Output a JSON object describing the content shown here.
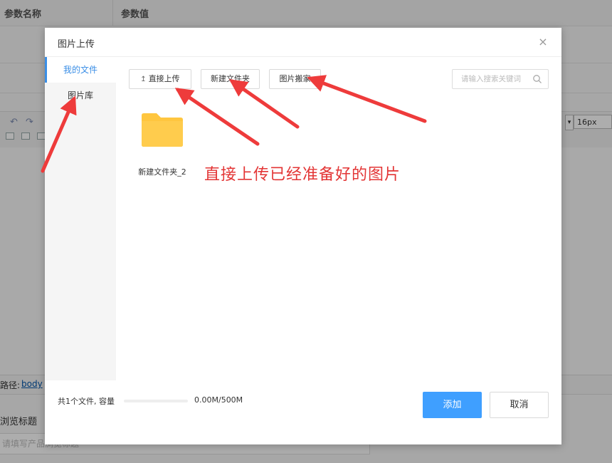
{
  "background": {
    "table_headers": [
      "参数名称",
      "参数值"
    ],
    "font_size_value": "16px",
    "select_arrow": "▾",
    "path_label": "路径:",
    "path_link": "body",
    "field_label": "浏览标题",
    "field_placeholder": "请填写产品浏览标题"
  },
  "dialog": {
    "title": "图片上传",
    "close_icon": "×",
    "sidebar": {
      "items": [
        {
          "label": "我的文件",
          "active": true
        },
        {
          "label": "图片库",
          "active": false
        }
      ]
    },
    "toolbar": {
      "upload_icon": "↥",
      "upload_label": "直接上传",
      "new_folder_label": "新建文件夹",
      "move_label": "图片搬家"
    },
    "search": {
      "placeholder": "请输入搜索关键词"
    },
    "files": [
      {
        "name": "新建文件夹_2",
        "type": "folder"
      }
    ],
    "annotation": "直接上传已经准备好的图片",
    "footer": {
      "file_count": "共1个文件,  容量",
      "capacity": "0.00M/500M",
      "capacity_used_fraction": 0.0,
      "add_label": "添加",
      "cancel_label": "取消"
    }
  },
  "colors": {
    "accent": "#3f9fff",
    "annotation_red": "#e33535",
    "folder_yellow": "#ffc63f"
  }
}
